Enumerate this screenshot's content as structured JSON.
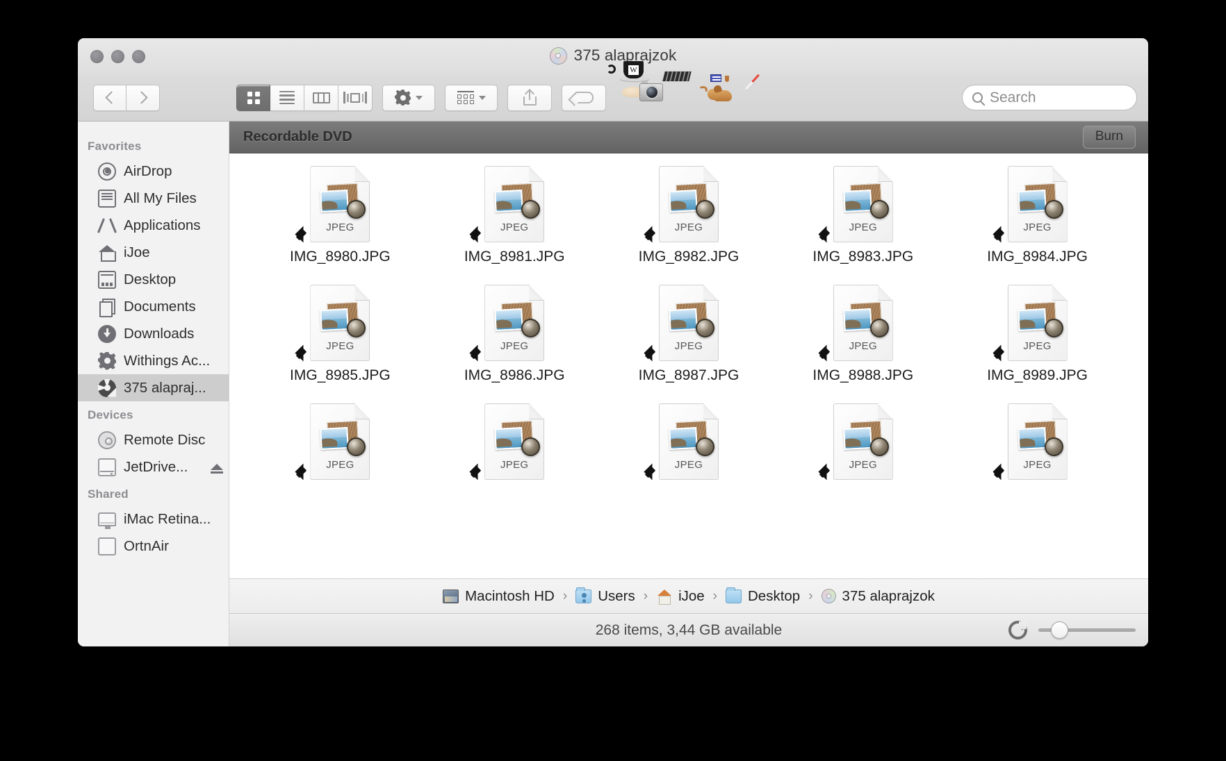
{
  "window": {
    "title": "375 alaprajzok",
    "title_icon": "optical-disc-icon",
    "traffic_lights": [
      "close",
      "minimize",
      "zoom"
    ]
  },
  "toolbar": {
    "back_label": "Back",
    "forward_label": "Forward",
    "views": [
      {
        "name": "icon-view",
        "label": "Icon View",
        "active": true
      },
      {
        "name": "list-view",
        "label": "List View",
        "active": false
      },
      {
        "name": "column-view",
        "label": "Column View",
        "active": false
      },
      {
        "name": "coverflow-view",
        "label": "Cover Flow View",
        "active": false
      }
    ],
    "action_label": "Action",
    "arrange_label": "Arrange",
    "share_label": "Share",
    "tag_label": "Edit Tags",
    "apps": [
      {
        "name": "caffeine-app-icon",
        "label": "W"
      },
      {
        "name": "image-capture-app-icon",
        "label": "Image Capture"
      },
      {
        "name": "graphicconverter-app-icon",
        "label": "GraphicConverter"
      },
      {
        "name": "safari-app-icon",
        "label": "Safari"
      }
    ]
  },
  "search": {
    "placeholder": "Search",
    "value": ""
  },
  "sidebar": {
    "sections": [
      {
        "title": "Favorites",
        "items": [
          {
            "label": "AirDrop",
            "icon": "airdrop-icon",
            "selected": false
          },
          {
            "label": "All My Files",
            "icon": "all-my-files-icon",
            "selected": false
          },
          {
            "label": "Applications",
            "icon": "applications-icon",
            "selected": false
          },
          {
            "label": "iJoe",
            "icon": "home-icon",
            "selected": false
          },
          {
            "label": "Desktop",
            "icon": "desktop-icon",
            "selected": false
          },
          {
            "label": "Documents",
            "icon": "documents-icon",
            "selected": false
          },
          {
            "label": "Downloads",
            "icon": "downloads-icon",
            "selected": false
          },
          {
            "label": "Withings Ac...",
            "icon": "gear-icon",
            "selected": false
          },
          {
            "label": "375 alapraj...",
            "icon": "burn-folder-icon",
            "selected": true
          }
        ]
      },
      {
        "title": "Devices",
        "items": [
          {
            "label": "Remote Disc",
            "icon": "optical-disc-icon",
            "selected": false
          },
          {
            "label": "JetDrive...",
            "icon": "external-drive-icon",
            "selected": false,
            "eject": true
          }
        ]
      },
      {
        "title": "Shared",
        "items": [
          {
            "label": "iMac Retina...",
            "icon": "imac-icon",
            "selected": false
          },
          {
            "label": "OrtnAir",
            "icon": "macbook-air-icon",
            "selected": false
          }
        ]
      }
    ]
  },
  "burn_bar": {
    "title": "Recordable DVD",
    "burn_label": "Burn"
  },
  "files": {
    "type_badge": "JPEG",
    "rows": [
      [
        "IMG_8980.JPG",
        "IMG_8981.JPG",
        "IMG_8982.JPG",
        "IMG_8983.JPG",
        "IMG_8984.JPG"
      ],
      [
        "IMG_8985.JPG",
        "IMG_8986.JPG",
        "IMG_8987.JPG",
        "IMG_8988.JPG",
        "IMG_8989.JPG"
      ],
      [
        "",
        "",
        "",
        "",
        ""
      ]
    ]
  },
  "path_bar": {
    "crumbs": [
      {
        "label": "Macintosh HD",
        "icon": "hard-drive-icon"
      },
      {
        "label": "Users",
        "icon": "users-folder-icon"
      },
      {
        "label": "iJoe",
        "icon": "home-folder-icon"
      },
      {
        "label": "Desktop",
        "icon": "folder-icon"
      },
      {
        "label": "375 alaprajzok",
        "icon": "optical-disc-icon"
      }
    ],
    "separator": "›"
  },
  "status_bar": {
    "text": "268 items, 3,44 GB available",
    "refresh_label": "Refresh",
    "zoom_value": 22
  },
  "colors": {
    "window_chrome": "#dcdcdc",
    "sidebar_bg": "#f2f2f2",
    "selection": "#cdcdcd",
    "burn_bar": "#6e6e6e",
    "accent_blue": "#2f9ede"
  }
}
